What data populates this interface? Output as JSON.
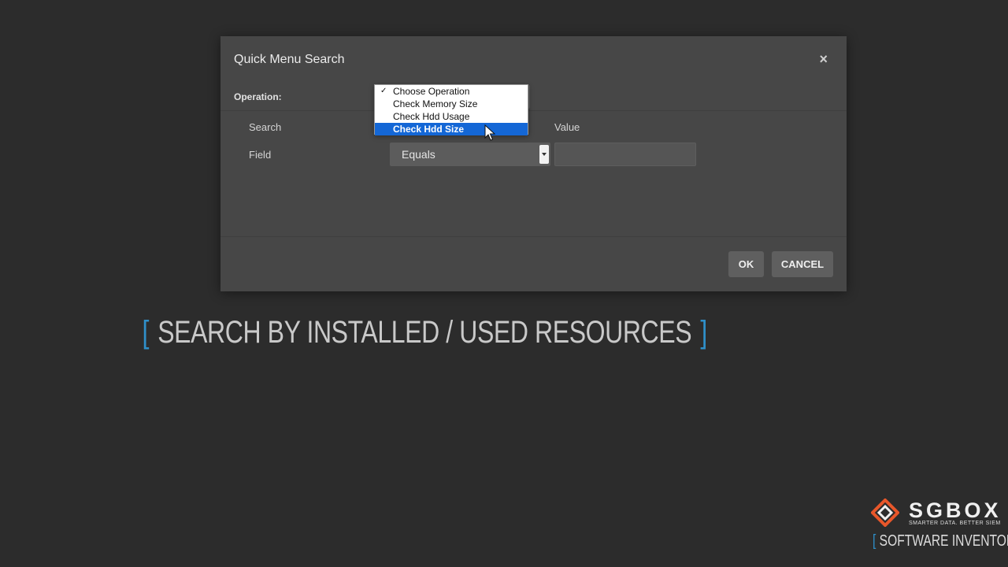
{
  "dialog": {
    "title": "Quick Menu Search",
    "close_label": "×",
    "operation_label": "Operation:",
    "columns": {
      "search": "Search",
      "value": "Value"
    },
    "field_label": "Field",
    "condition_value": "Equals",
    "value_input": "",
    "buttons": {
      "ok": "OK",
      "cancel": "CANCEL"
    }
  },
  "dropdown": {
    "options": [
      {
        "label": "Choose Operation",
        "checked": true
      },
      {
        "label": "Check Memory Size"
      },
      {
        "label": "Check Hdd Usage"
      },
      {
        "label": "Check Hdd Size",
        "highlighted": true
      }
    ],
    "check_mark": "✓"
  },
  "banner": {
    "bracket_open": "[",
    "text": "SEARCH BY INSTALLED / USED RESOURCES",
    "bracket_close": "]"
  },
  "branding": {
    "logo": "SGBOX",
    "tagline": "SMARTER DATA. BETTER SIEM",
    "bracket": "[",
    "subtitle": "SOFTWARE INVENTORY"
  },
  "colors": {
    "accent": "#2f8fc9",
    "selection": "#1467d6",
    "logo_orange": "#e8572a"
  }
}
